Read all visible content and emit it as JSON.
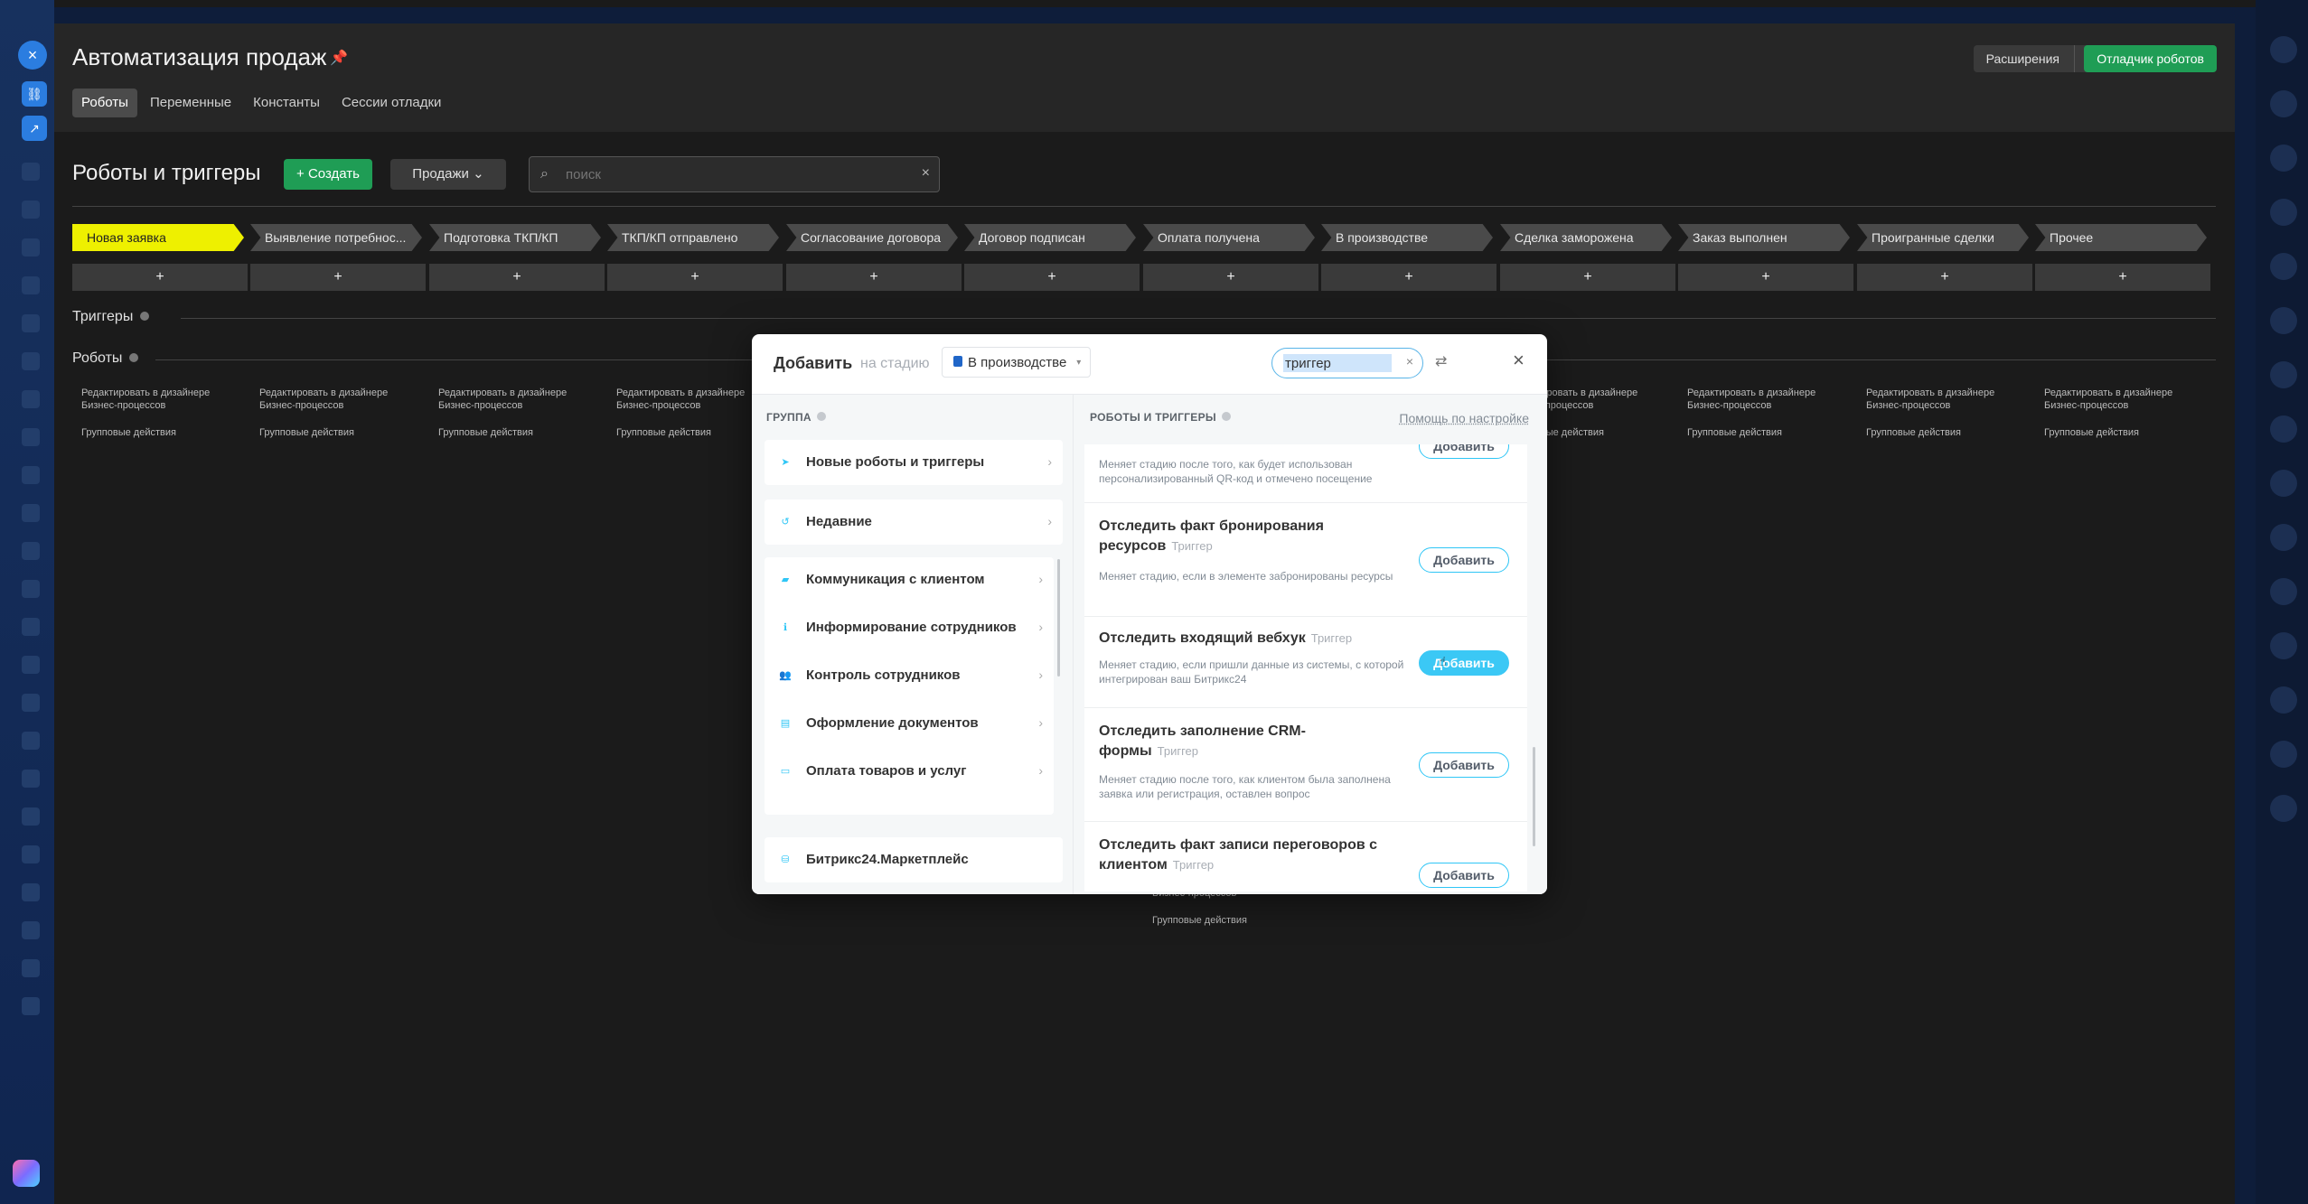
{
  "page": {
    "title": "Автоматизация продаж",
    "extensions_label": "Расширения",
    "debugger_label": "Отладчик роботов",
    "tabs": [
      "Роботы",
      "Переменные",
      "Константы",
      "Сессии отладки"
    ]
  },
  "toolbar": {
    "section_title": "Роботы и триггеры",
    "create_label": "Создать",
    "funnel_label": "Продажи",
    "search_placeholder": "поиск"
  },
  "stages": [
    "Новая заявка",
    "Выявление потребнос...",
    "Подготовка ТКП/КП",
    "ТКП/КП отправлено",
    "Согласование договора",
    "Договор подписан",
    "Оплата получена",
    "В производстве",
    "Сделка заморожена",
    "Заказ выполнен",
    "Проигранные сделки",
    "Прочее"
  ],
  "sections": {
    "triggers": "Триггеры",
    "robots": "Роботы"
  },
  "column_links": {
    "edit": "Редактировать в дизайнере Бизнес-процессов",
    "group": "Групповые действия"
  },
  "dialog": {
    "title": "Добавить",
    "subtitle": "на стадию",
    "stage": "В производстве",
    "search_value": "триггер",
    "group_header": "ГРУППА",
    "robots_header": "РОБОТЫ И ТРИГГЕРЫ",
    "help_link": "Помощь по настройке",
    "groups_top": [
      "Новые роботы и триггеры",
      "Недавние"
    ],
    "groups": [
      "Коммуникация с клиентом",
      "Информирование сотрудников",
      "Контроль сотрудников",
      "Оформление документов",
      "Оплата товаров и услуг"
    ],
    "group_bottom": "Битрикс24.Маркетплейс",
    "add_label": "Добавить",
    "trigger_tag": "Триггер",
    "items": [
      {
        "name": "",
        "desc": "Меняет стадию после того, как будет использован персонализированный QR-код и отмечено посещение"
      },
      {
        "name": "Отследить факт бронирования ресурсов",
        "desc": "Меняет стадию, если в элементе забронированы ресурсы"
      },
      {
        "name": "Отследить входящий вебхук",
        "desc": "Меняет стадию, если пришли данные из системы, с которой интегрирован ваш Битрикс24"
      },
      {
        "name": "Отследить заполнение CRM-формы",
        "desc": "Меняет стадию после того, как клиентом была заполнена заявка или регистрация, оставлен вопрос"
      },
      {
        "name": "Отследить факт записи переговоров с клиентом",
        "desc": ""
      }
    ]
  }
}
